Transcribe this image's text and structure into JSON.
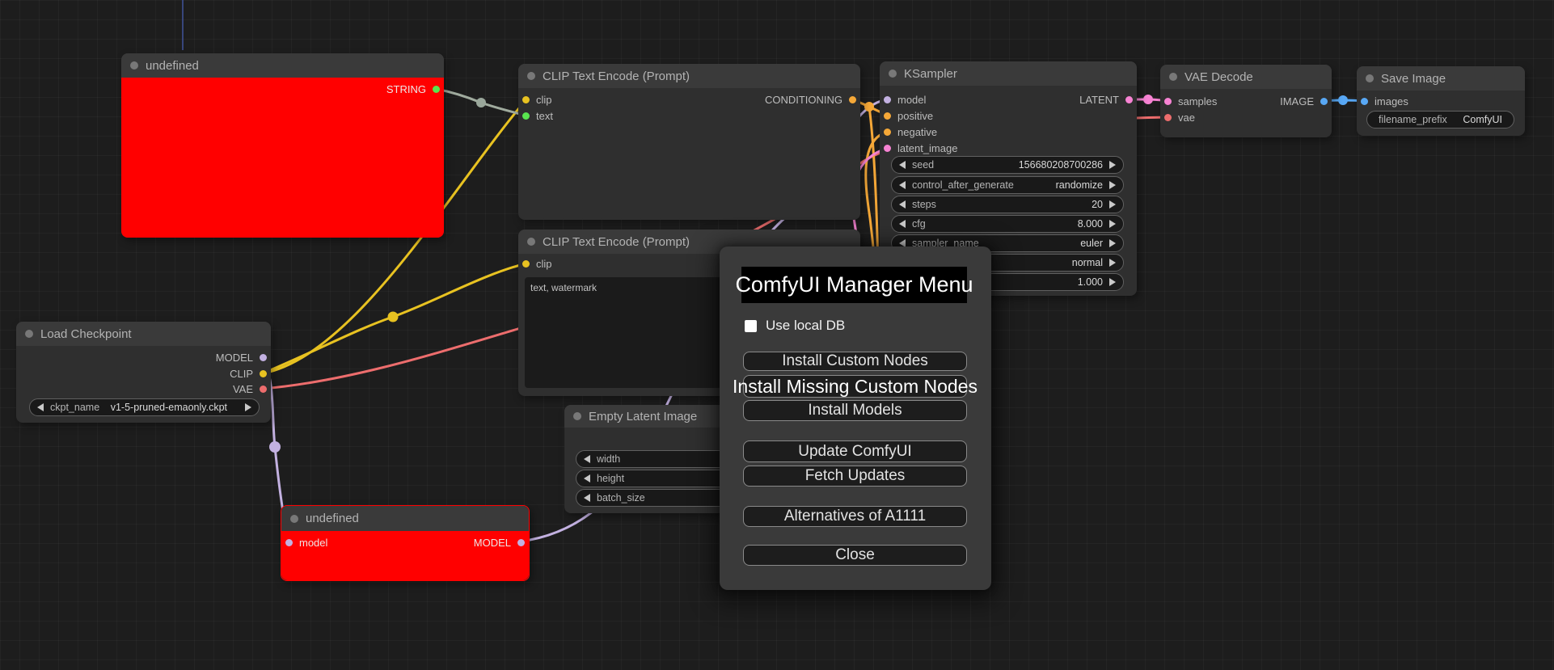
{
  "dialog": {
    "title": "ComfyUI Manager Menu",
    "use_local_db_label": "Use local DB",
    "buttons": {
      "install_custom_nodes": "Install Custom Nodes",
      "install_missing_custom_nodes": "Install Missing Custom Nodes",
      "install_models": "Install Models",
      "update_comfyui": "Update ComfyUI",
      "fetch_updates": "Fetch Updates",
      "alternatives_a1111": "Alternatives of A1111",
      "close": "Close"
    }
  },
  "nodes": {
    "undefined_string": {
      "title": "undefined",
      "outputs": {
        "string": "STRING"
      }
    },
    "clip_encode_positive": {
      "title": "CLIP Text Encode (Prompt)",
      "inputs": {
        "clip": "clip",
        "text": "text"
      },
      "outputs": {
        "conditioning": "CONDITIONING"
      }
    },
    "clip_encode_negative": {
      "title": "CLIP Text Encode (Prompt)",
      "inputs": {
        "clip": "clip"
      },
      "text_value": "text, watermark"
    },
    "ksampler": {
      "title": "KSampler",
      "inputs": {
        "model": "model",
        "positive": "positive",
        "negative": "negative",
        "latent_image": "latent_image"
      },
      "outputs": {
        "latent": "LATENT"
      },
      "widgets": [
        {
          "label": "seed",
          "value": "156680208700286"
        },
        {
          "label": "control_after_generate",
          "value": "randomize"
        },
        {
          "label": "steps",
          "value": "20"
        },
        {
          "label": "cfg",
          "value": "8.000"
        },
        {
          "label": "sampler_name",
          "value": "euler"
        },
        {
          "label": "",
          "value": "normal"
        },
        {
          "label": "",
          "value": "1.000"
        }
      ]
    },
    "vae_decode": {
      "title": "VAE Decode",
      "inputs": {
        "samples": "samples",
        "vae": "vae"
      },
      "outputs": {
        "image": "IMAGE"
      }
    },
    "save_image": {
      "title": "Save Image",
      "inputs": {
        "images": "images"
      },
      "widgets": [
        {
          "label": "filename_prefix",
          "value": "ComfyUI"
        }
      ]
    },
    "load_checkpoint": {
      "title": "Load Checkpoint",
      "outputs": {
        "model": "MODEL",
        "clip": "CLIP",
        "vae": "VAE"
      },
      "widgets": [
        {
          "label": "ckpt_name",
          "value": "v1-5-pruned-emaonly.ckpt"
        }
      ]
    },
    "empty_latent_image": {
      "title": "Empty Latent Image",
      "widgets": [
        {
          "label": "width",
          "value": ""
        },
        {
          "label": "height",
          "value": ""
        },
        {
          "label": "batch_size",
          "value": ""
        }
      ]
    },
    "undefined_model": {
      "title": "undefined",
      "inputs": {
        "model": "model"
      },
      "outputs": {
        "model_out": "MODEL"
      }
    }
  },
  "colors": {
    "model": "#c3b1e1",
    "clip": "#e8c221",
    "vae": "#ed6d6d",
    "conditioning": "#f5a838",
    "latent": "#f783d3",
    "image": "#58a8f5",
    "string": "#59e54f",
    "reroute_gray": "#a0ab9e",
    "node_error": "#ff0000"
  }
}
